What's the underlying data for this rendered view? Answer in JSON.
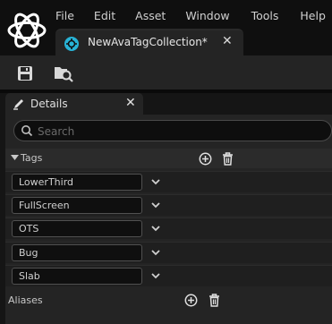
{
  "menu": [
    "File",
    "Edit",
    "Asset",
    "Window",
    "Tools",
    "Help"
  ],
  "document_tab": {
    "title": "NewAvaTagCollection*",
    "close": "✕"
  },
  "toolbar": {
    "save_icon": "save-icon",
    "browse_icon": "browse-asset-icon"
  },
  "details": {
    "tab_label": "Details",
    "close": "✕",
    "search_placeholder": "Search",
    "tags_header": "Tags",
    "tags": [
      "LowerThird",
      "FullScreen",
      "OTS",
      "Bug",
      "Slab"
    ],
    "aliases_label": "Aliases"
  },
  "colors": {
    "panel": "#242424",
    "background": "#151515",
    "field": "#0f0f0f",
    "text": "#c0c0c0"
  }
}
